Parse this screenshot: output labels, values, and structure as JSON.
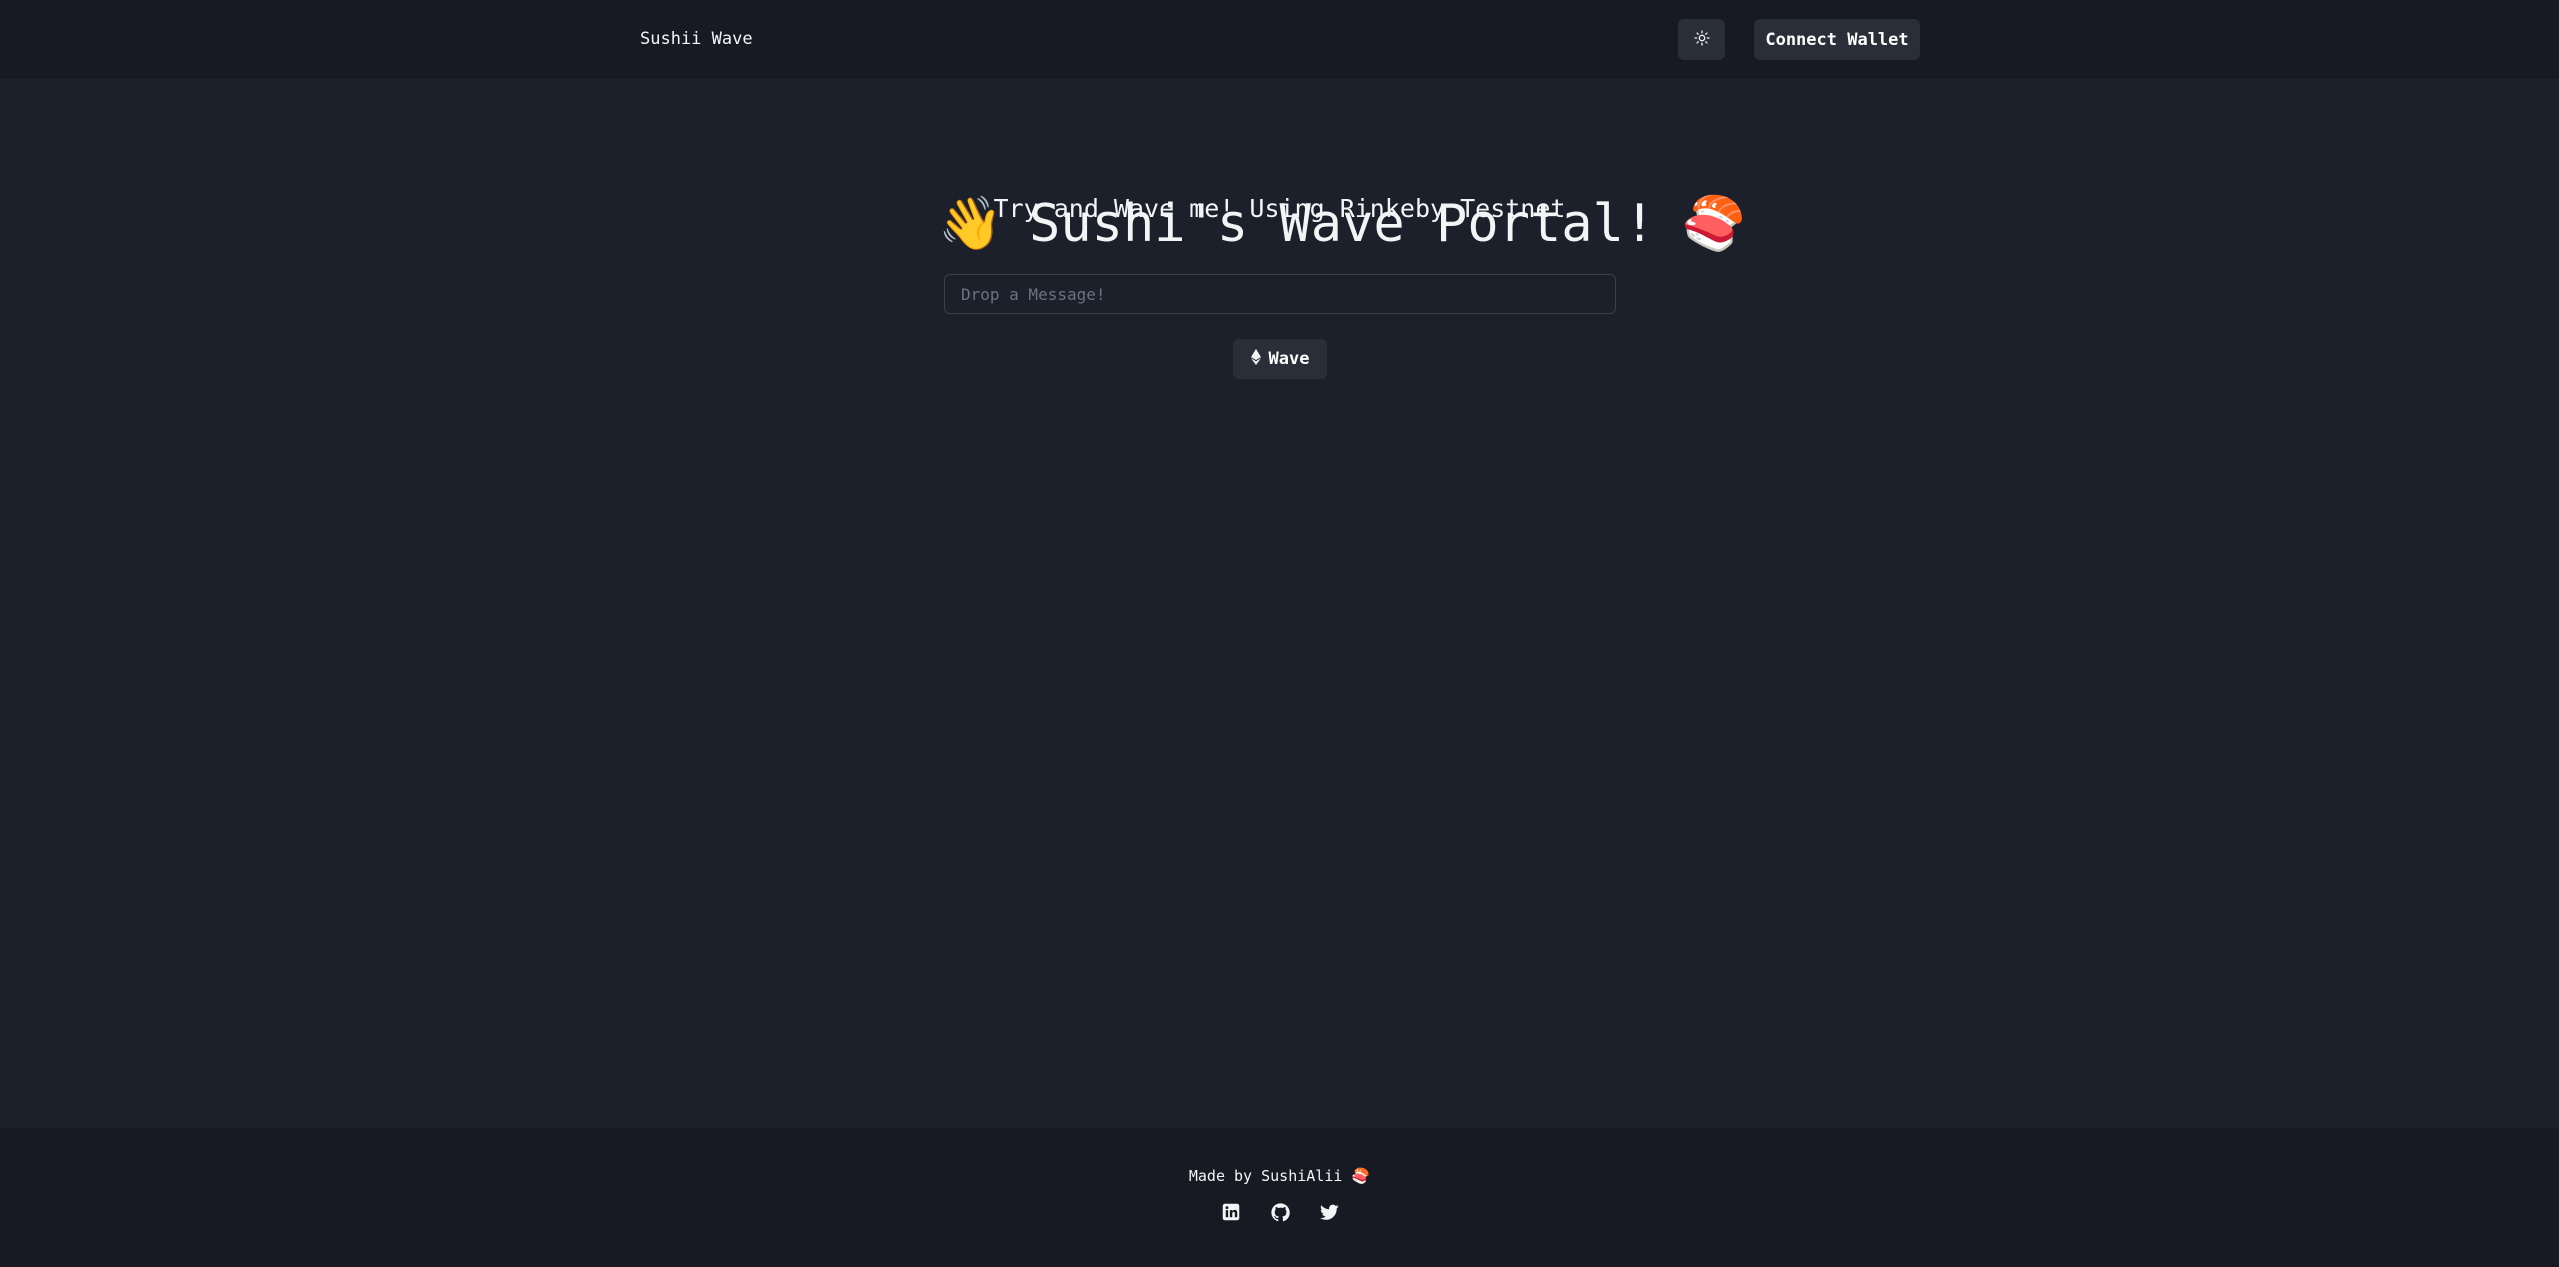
{
  "header": {
    "brand": "Sushii Wave",
    "theme_toggle_icon": "sun-icon",
    "connect_wallet_label": "Connect Wallet"
  },
  "hero": {
    "left_emoji": "👋",
    "title": "Sushi's Wave Portal!",
    "right_emoji": "🍣",
    "subtitle": "Try and Wave me! Using Rinkeby Testnet"
  },
  "form": {
    "message_placeholder": "Drop a Message!",
    "message_value": "",
    "wave_icon": "ethereum-icon",
    "wave_label": "Wave"
  },
  "footer": {
    "made_by": "Made by SushiAlii 🍣",
    "socials": [
      "linkedin-icon",
      "github-icon",
      "twitter-icon"
    ]
  },
  "colors": {
    "background": "#1b202b",
    "header_footer": "#171a22",
    "button": "#2a2e38",
    "text": "#f3f4f6"
  }
}
